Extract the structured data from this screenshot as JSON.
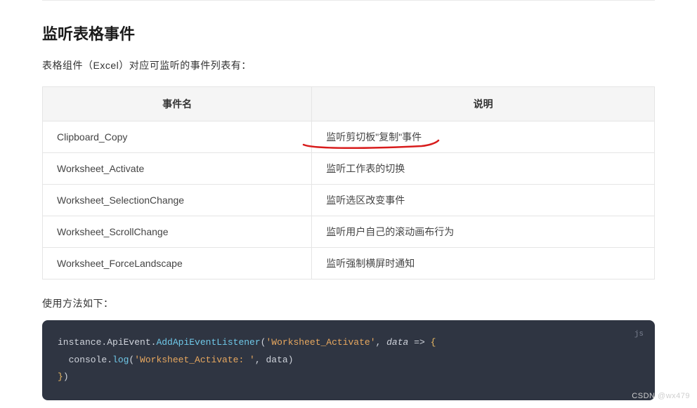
{
  "heading": "监听表格事件",
  "intro": "表格组件（Excel）对应可监听的事件列表有：",
  "table": {
    "headers": {
      "event": "事件名",
      "desc": "说明"
    },
    "rows": [
      {
        "event": "Clipboard_Copy",
        "desc": "监听剪切板\"复制\"事件"
      },
      {
        "event": "Worksheet_Activate",
        "desc": "监听工作表的切换"
      },
      {
        "event": "Worksheet_SelectionChange",
        "desc": "监听选区改变事件"
      },
      {
        "event": "Worksheet_ScrollChange",
        "desc": "监听用户自己的滚动画布行为"
      },
      {
        "event": "Worksheet_ForceLandscape",
        "desc": "监听强制横屏时通知"
      }
    ]
  },
  "usage_label": "使用方法如下：",
  "code": {
    "lang": "js",
    "obj": "instance.ApiEvent.",
    "method": "AddApiEventListener",
    "open": "(",
    "arg1": "'Worksheet_Activate'",
    "sep1": ", ",
    "param": "data",
    "arrow": " => ",
    "lbrace": "{",
    "inner_obj": "console.",
    "inner_method": "log",
    "inner_open": "(",
    "inner_arg1": "'Worksheet_Activate: '",
    "inner_sep": ", ",
    "inner_arg2": "data",
    "inner_close": ")",
    "rbrace": "}",
    "close": ")"
  },
  "watermark": "CSDN @wx479"
}
